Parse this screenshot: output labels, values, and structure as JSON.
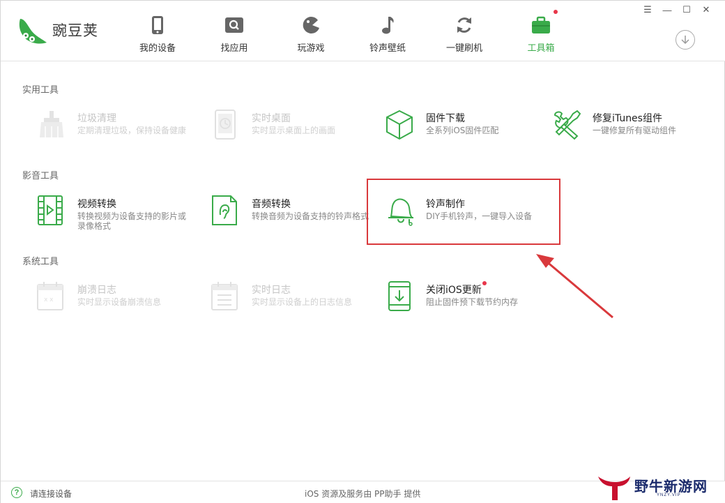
{
  "app": {
    "name": "豌豆荚"
  },
  "nav": {
    "items": [
      {
        "label": "我的设备",
        "icon": "phone-icon"
      },
      {
        "label": "找应用",
        "icon": "app-search-icon"
      },
      {
        "label": "玩游戏",
        "icon": "game-icon"
      },
      {
        "label": "铃声壁纸",
        "icon": "music-note-icon"
      },
      {
        "label": "一键刷机",
        "icon": "refresh-icon"
      },
      {
        "label": "工具箱",
        "icon": "toolbox-icon",
        "active": true,
        "badge": true
      }
    ]
  },
  "window_controls": [
    "☰",
    "—",
    "☐",
    "✕"
  ],
  "sections": [
    {
      "title": "实用工具",
      "tools": [
        {
          "name": "垃圾清理",
          "desc": "定期清理垃圾，保持设备健康",
          "disabled": true
        },
        {
          "name": "实时桌面",
          "desc": "实时显示桌面上的画面",
          "disabled": true
        },
        {
          "name": "固件下载",
          "desc": "全系列iOS固件匹配",
          "disabled": false
        },
        {
          "name": "修复iTunes组件",
          "desc": "一键修复所有驱动组件",
          "disabled": false
        }
      ]
    },
    {
      "title": "影音工具",
      "tools": [
        {
          "name": "视频转换",
          "desc": "转换视频为设备支持的影片或录像格式",
          "disabled": false
        },
        {
          "name": "音频转换",
          "desc": "转换音频为设备支持的铃声格式",
          "disabled": false
        },
        {
          "name": "铃声制作",
          "desc": "DIY手机铃声，一键导入设备",
          "disabled": false,
          "highlighted": true
        }
      ]
    },
    {
      "title": "系统工具",
      "tools": [
        {
          "name": "崩溃日志",
          "desc": "实时显示设备崩溃信息",
          "disabled": true
        },
        {
          "name": "实时日志",
          "desc": "实时显示设备上的日志信息",
          "disabled": true
        },
        {
          "name": "关闭iOS更新",
          "desc": "阻止固件预下载节约内存",
          "disabled": false,
          "badge": true
        }
      ]
    }
  ],
  "status": {
    "connect_text": "请连接设备",
    "provider_text": "iOS 资源及服务由 PP助手 提供"
  },
  "watermark": {
    "text": "野牛新游网",
    "sub": "YNZY.VIP"
  },
  "colors": {
    "accent": "#3aab4a",
    "badge": "#e8364a",
    "annotation": "#d9393c",
    "disabled": "#c5c5c5"
  }
}
